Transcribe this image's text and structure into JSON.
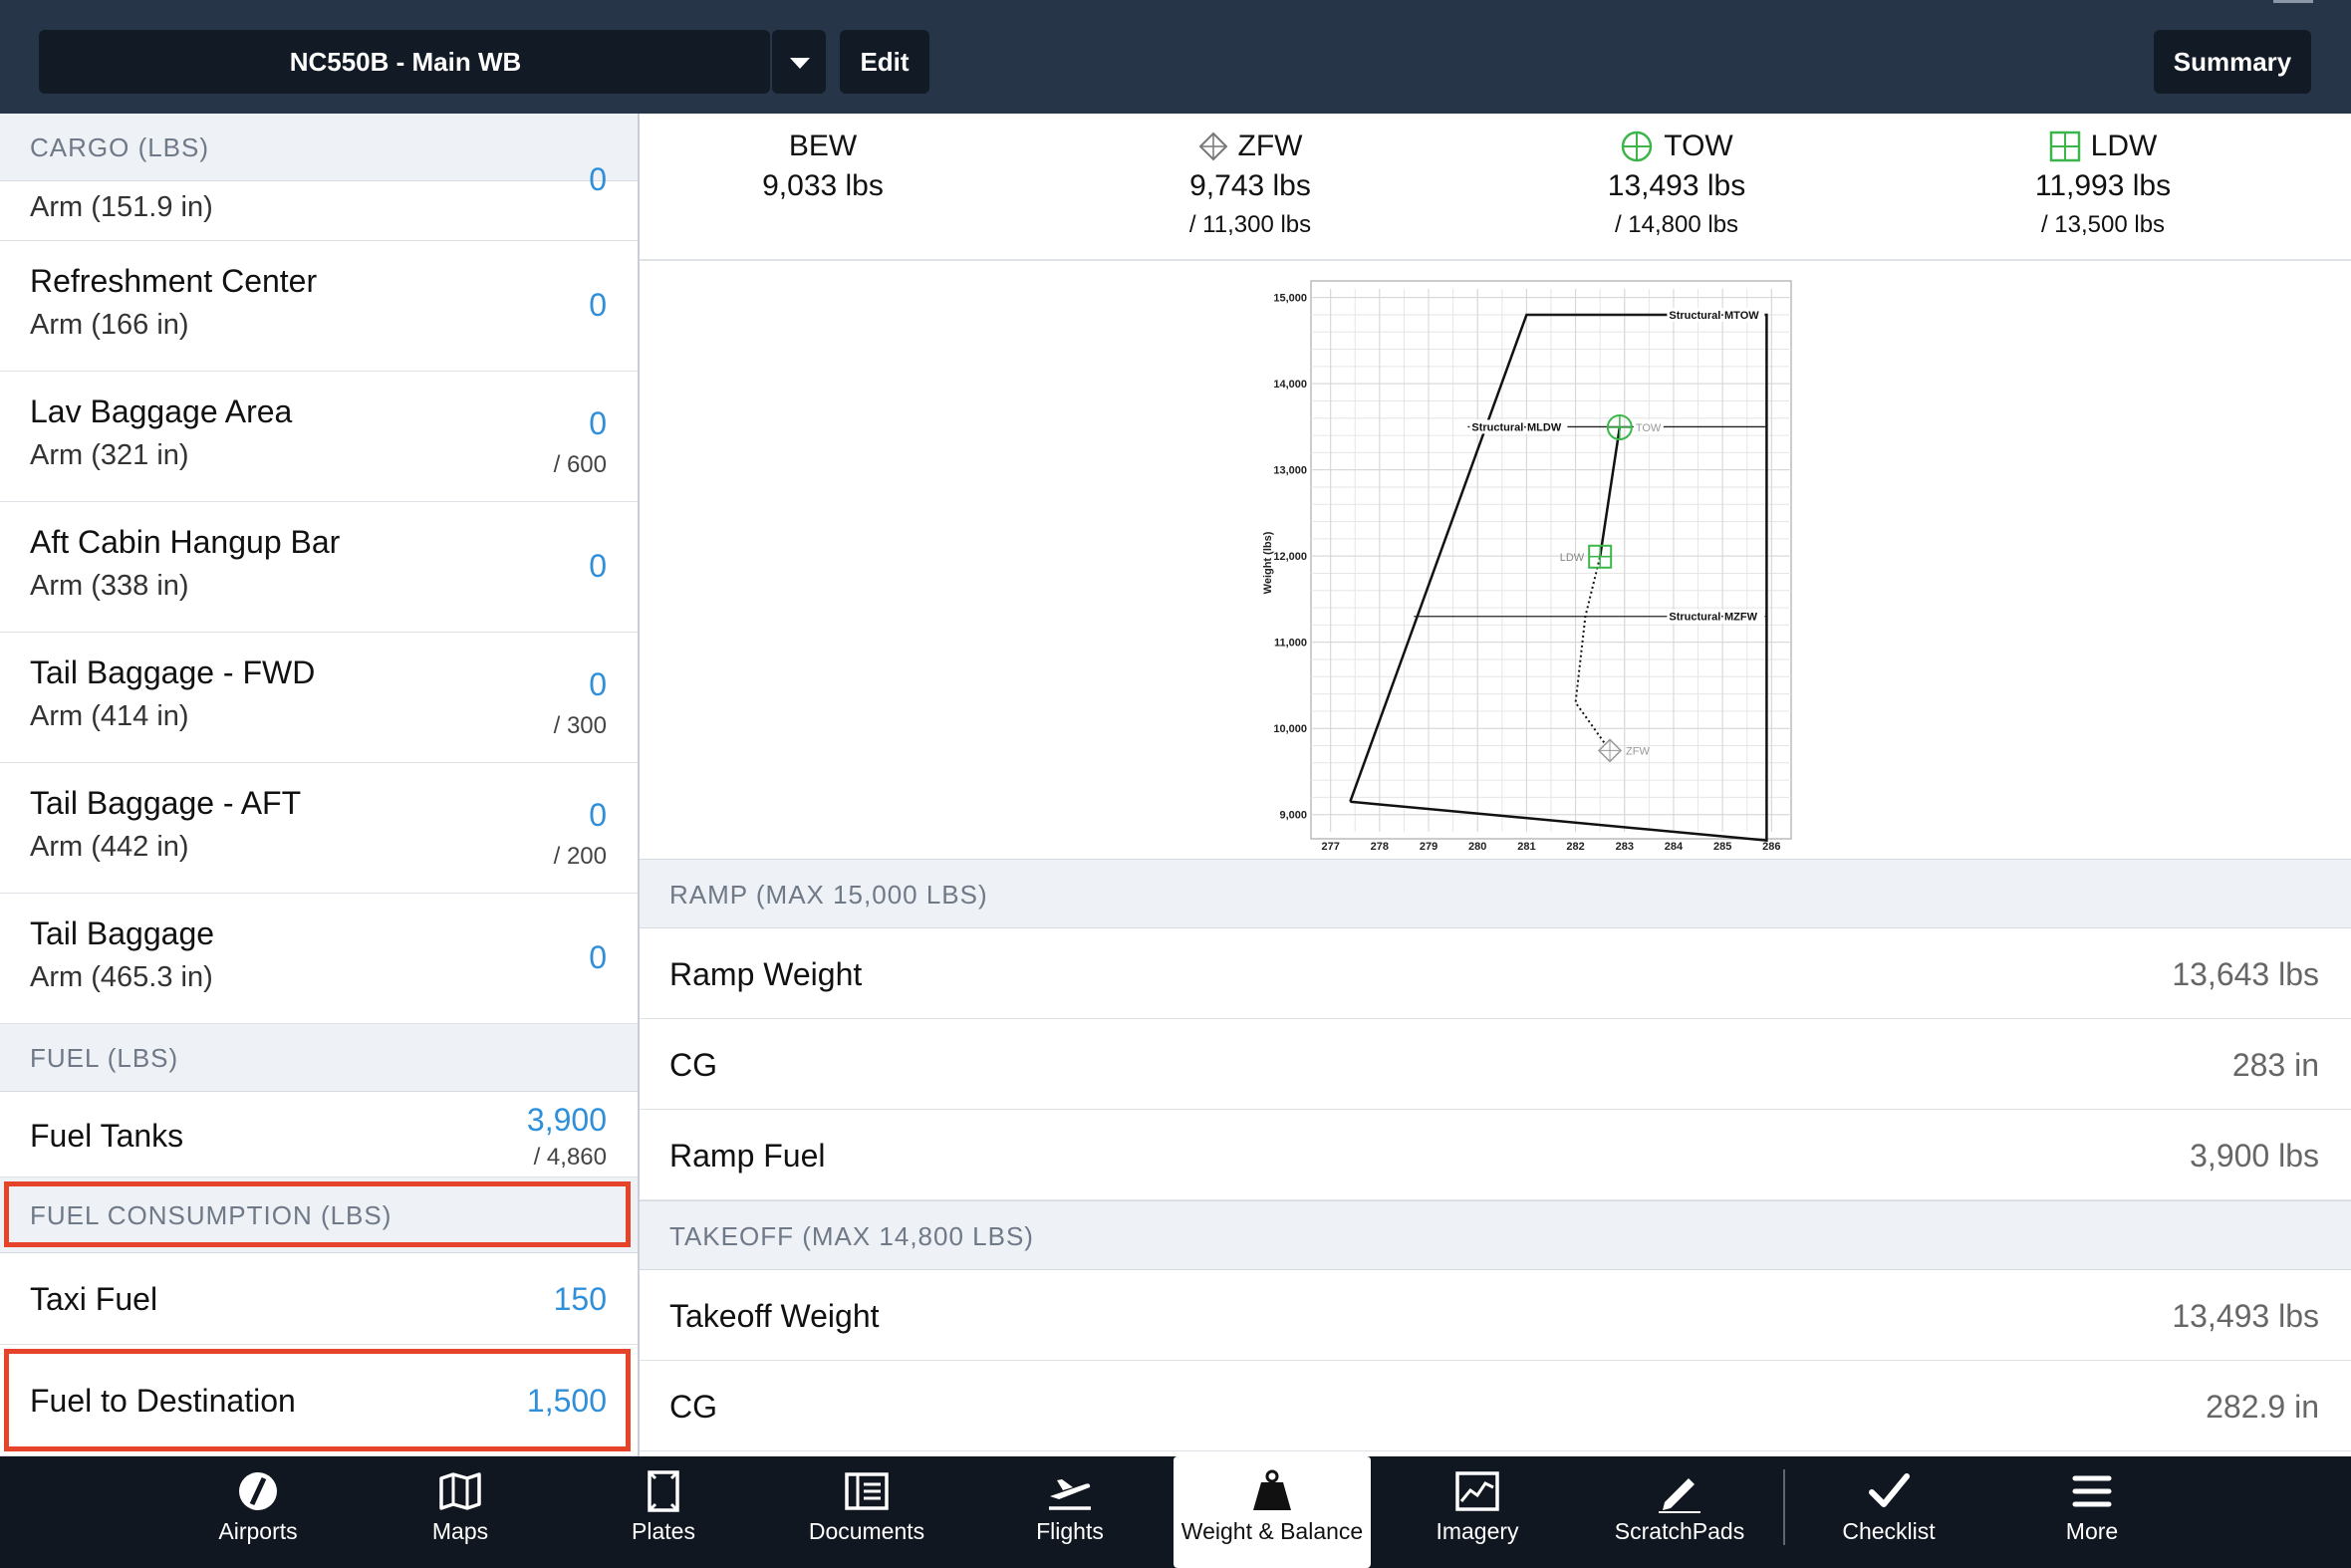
{
  "header": {
    "profile": "NC550B - Main WB",
    "edit_label": "Edit",
    "summary_label": "Summary"
  },
  "left": {
    "cargo_header": "CARGO (LBS)",
    "cargo_partial_arm": "Arm (151.9 in)",
    "cargo_partial_value": "0",
    "items": [
      {
        "title": "Refreshment Center",
        "arm": "Arm (166 in)",
        "value": "0",
        "max": ""
      },
      {
        "title": "Lav Baggage Area",
        "arm": "Arm (321 in)",
        "value": "0",
        "max": "/ 600"
      },
      {
        "title": "Aft Cabin Hangup Bar",
        "arm": "Arm (338 in)",
        "value": "0",
        "max": ""
      },
      {
        "title": "Tail Baggage - FWD",
        "arm": "Arm (414 in)",
        "value": "0",
        "max": "/ 300"
      },
      {
        "title": "Tail Baggage - AFT",
        "arm": "Arm (442 in)",
        "value": "0",
        "max": "/ 200"
      },
      {
        "title": "Tail Baggage",
        "arm": "Arm (465.3 in)",
        "value": "0",
        "max": ""
      }
    ],
    "fuel_header": "FUEL (LBS)",
    "fuel_tanks": {
      "title": "Fuel Tanks",
      "value": "3,900",
      "max": "/ 4,860"
    },
    "consumption_header": "FUEL CONSUMPTION (LBS)",
    "taxi_fuel": {
      "title": "Taxi Fuel",
      "value": "150"
    },
    "fuel_to_dest": {
      "title": "Fuel to Destination",
      "value": "1,500"
    }
  },
  "stats": {
    "bew": {
      "label": "BEW",
      "weight": "9,033 lbs",
      "max": ""
    },
    "zfw": {
      "label": "ZFW",
      "weight": "9,743 lbs",
      "max": "/ 11,300 lbs"
    },
    "tow": {
      "label": "TOW",
      "weight": "13,493 lbs",
      "max": "/ 14,800 lbs"
    },
    "ldw": {
      "label": "LDW",
      "weight": "11,993 lbs",
      "max": "/ 13,500 lbs"
    }
  },
  "ramp": {
    "header": "RAMP (MAX 15,000 LBS)",
    "rows": [
      {
        "label": "Ramp Weight",
        "value": "13,643 lbs"
      },
      {
        "label": "CG",
        "value": "283 in"
      },
      {
        "label": "Ramp Fuel",
        "value": "3,900 lbs"
      }
    ]
  },
  "takeoff": {
    "header": "TAKEOFF (MAX 14,800 LBS)",
    "rows": [
      {
        "label": "Takeoff Weight",
        "value": "13,493 lbs"
      },
      {
        "label": "CG",
        "value": "282.9 in"
      }
    ]
  },
  "chart_data": {
    "type": "scatter",
    "title": "",
    "xlabel": "",
    "ylabel": "Weight (lbs)",
    "xlim": [
      276.6,
      286.4
    ],
    "ylim": [
      8800,
      15100
    ],
    "x_ticks": [
      277,
      278,
      279,
      280,
      281,
      282,
      283,
      284,
      285,
      286
    ],
    "y_ticks": [
      9000,
      10000,
      11000,
      12000,
      13000,
      14000,
      15000
    ],
    "y_tick_labels": [
      "9,000",
      "10,000",
      "11,000",
      "12,000",
      "13,000",
      "14,000",
      "15,000"
    ],
    "grid": true,
    "envelope": [
      {
        "x": 277.4,
        "y": 9150
      },
      {
        "x": 281.0,
        "y": 14800
      },
      {
        "x": 285.9,
        "y": 14800
      },
      {
        "x": 285.9,
        "y": 8700
      },
      {
        "x": 277.4,
        "y": 9150
      }
    ],
    "limit_lines": [
      {
        "name": "Structural MTOW",
        "y": 14800,
        "x_from": 281.0,
        "x_to": 285.9
      },
      {
        "name": "Structural MLDW",
        "y": 13500,
        "x_from": 279.8,
        "x_to": 285.9
      },
      {
        "name": "Structural MZFW",
        "y": 11300,
        "x_from": 278.7,
        "x_to": 285.9
      }
    ],
    "points": [
      {
        "name": "ZFW",
        "x": 282.7,
        "y": 9743
      },
      {
        "name": "LDW",
        "x": 282.5,
        "y": 11993
      },
      {
        "name": "TOW",
        "x": 282.9,
        "y": 13493
      }
    ],
    "burn_path": [
      {
        "x": 282.7,
        "y": 9743
      },
      {
        "x": 282.0,
        "y": 10300
      },
      {
        "x": 282.2,
        "y": 11300
      },
      {
        "x": 282.5,
        "y": 11993
      },
      {
        "x": 282.9,
        "y": 13493
      }
    ]
  },
  "tabs": [
    {
      "label": "Airports",
      "icon": "airports-icon"
    },
    {
      "label": "Maps",
      "icon": "maps-icon"
    },
    {
      "label": "Plates",
      "icon": "plates-icon"
    },
    {
      "label": "Documents",
      "icon": "documents-icon"
    },
    {
      "label": "Flights",
      "icon": "flights-icon"
    },
    {
      "label": "Weight & Balance",
      "icon": "weight-balance-icon",
      "active": true
    },
    {
      "label": "Imagery",
      "icon": "imagery-icon"
    },
    {
      "label": "ScratchPads",
      "icon": "scratchpads-icon"
    },
    {
      "label": "Checklist",
      "icon": "checklist-icon"
    },
    {
      "label": "More",
      "icon": "more-icon"
    }
  ],
  "colors": {
    "header": "#263548",
    "value_blue": "#2f8fd8",
    "highlight": "#e5432a",
    "green": "#3cb64a",
    "tabbar": "#111720"
  }
}
